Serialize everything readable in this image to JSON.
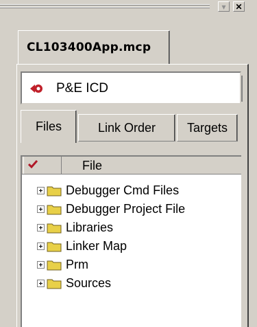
{
  "project": {
    "file_tab_label": "CL103400App.mcp"
  },
  "target": {
    "name": "P&E ICD",
    "icon": "debug-target-icon",
    "icon_color": "#c0202a"
  },
  "tabs": [
    {
      "label": "Files",
      "active": true
    },
    {
      "label": "Link Order",
      "active": false
    },
    {
      "label": "Targets",
      "active": false
    }
  ],
  "file_list": {
    "header": {
      "check_icon": "checkmark-icon",
      "column_label": "File",
      "check_color": "#b01828"
    },
    "items": [
      {
        "name": "Debugger Cmd Files",
        "icon": "folder-icon"
      },
      {
        "name": "Debugger Project File",
        "icon": "folder-icon"
      },
      {
        "name": "Libraries",
        "icon": "folder-icon"
      },
      {
        "name": "Linker Map",
        "icon": "folder-icon"
      },
      {
        "name": "Prm",
        "icon": "folder-icon"
      },
      {
        "name": "Sources",
        "icon": "folder-icon"
      }
    ]
  },
  "window": {
    "minimize_icon": "minimize-icon",
    "close_icon": "close-icon"
  },
  "colors": {
    "face": "#d4d0c8",
    "folder": "#e8d048"
  }
}
